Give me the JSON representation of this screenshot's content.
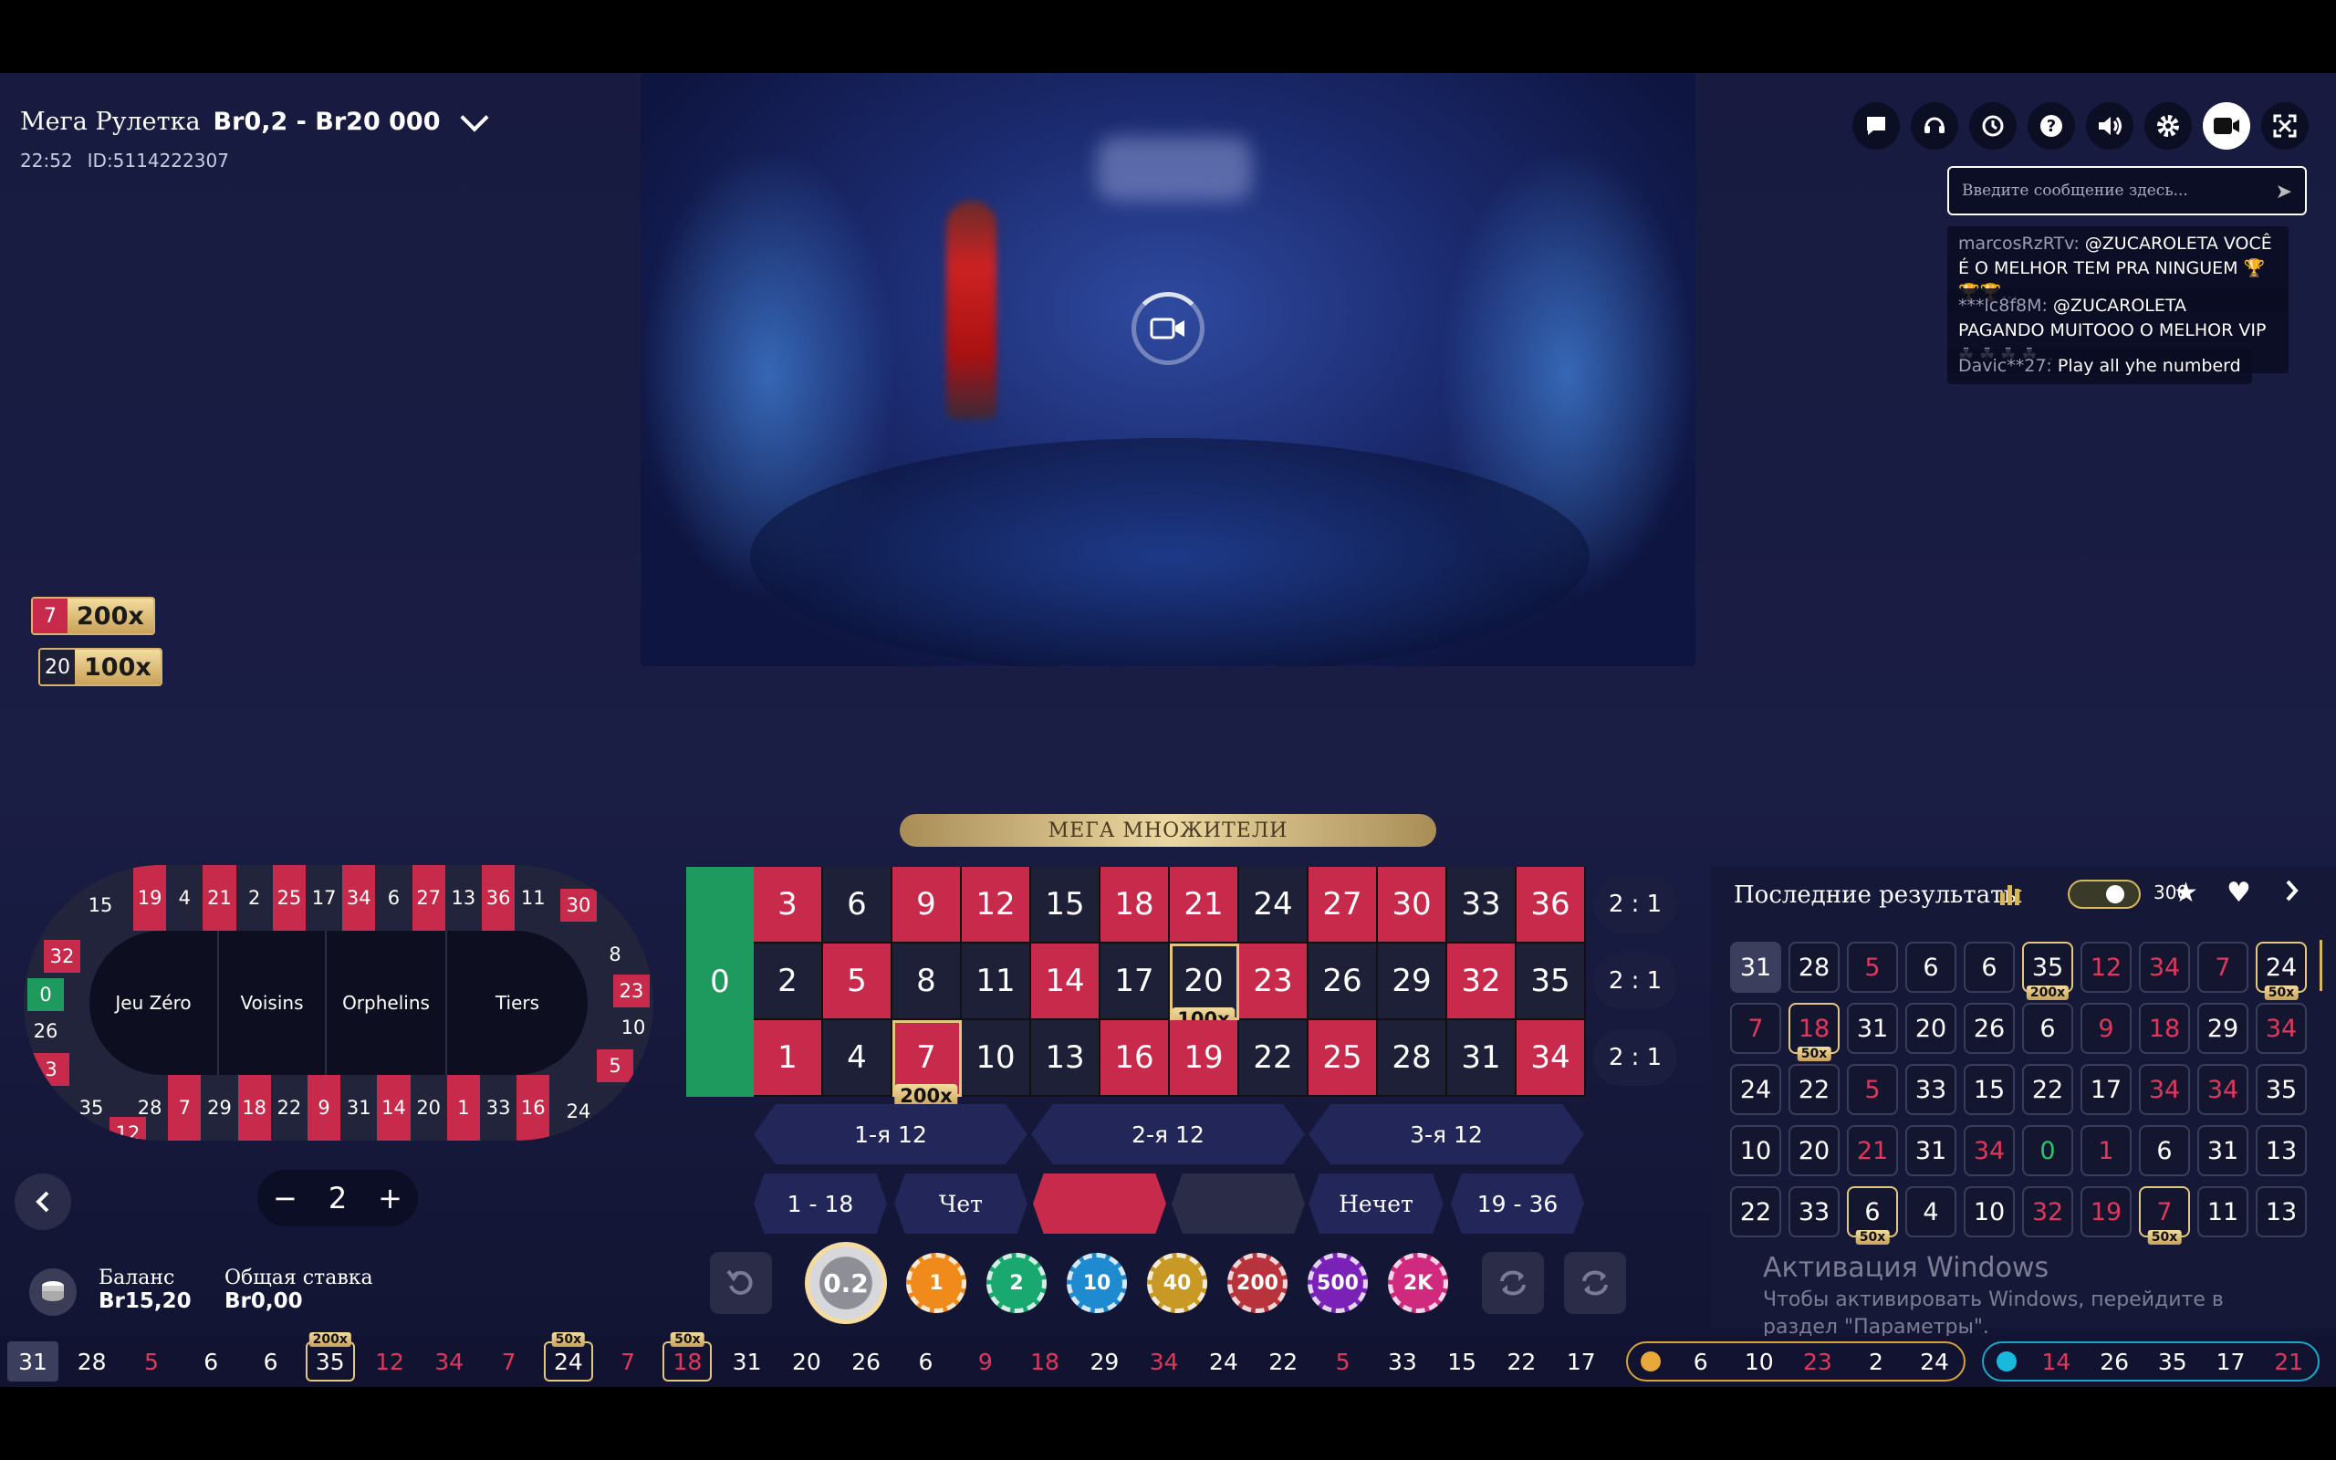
{
  "header": {
    "game_name": "Мега Рулетка",
    "limits": "Br0,2 - Br20 000",
    "time": "22:52",
    "id": "ID:5114222307"
  },
  "toolbar_icons": [
    "chat-icon",
    "support-icon",
    "history-icon",
    "help-icon",
    "sound-icon",
    "settings-icon",
    "video-icon",
    "fullscreen-icon"
  ],
  "chat": {
    "placeholder": "Введите сообщение здесь...",
    "messages": [
      {
        "user": "marcosRzRTv:",
        "text": " @ZUCAROLETA VOCÊ É O MELHOR TEM PRA NINGUEM 🏆🏆🏆..."
      },
      {
        "user": "***lc8f8M:",
        "text": " @ZUCAROLETA PAGANDO MUITOOO O MELHOR VIP ☘ ☘ ☘ ☘..."
      },
      {
        "user": "Davic**27:",
        "text": " Play all yhe numberd"
      }
    ]
  },
  "multipliers": [
    {
      "number": "7",
      "mult": "200x"
    },
    {
      "number": "20",
      "mult": "100x"
    }
  ],
  "racetrack": {
    "sections": [
      "Jeu Zéro",
      "Voisins",
      "Orphelins",
      "Tiers"
    ],
    "top": [
      "19",
      "4",
      "21",
      "2",
      "25",
      "17",
      "34",
      "6",
      "27",
      "13",
      "36",
      "11"
    ],
    "bottom": [
      "28",
      "7",
      "29",
      "18",
      "22",
      "9",
      "31",
      "14",
      "20",
      "1",
      "33",
      "16"
    ],
    "left": [
      "15",
      "32",
      "0",
      "26",
      "3",
      "35",
      "12"
    ],
    "right": [
      "30",
      "8",
      "23",
      "10",
      "5",
      "24"
    ]
  },
  "banner": "МЕГА МНОЖИТЕЛИ",
  "table": {
    "zero": "0",
    "rows": [
      [
        "3",
        "6",
        "9",
        "12",
        "15",
        "18",
        "21",
        "24",
        "27",
        "30",
        "33",
        "36"
      ],
      [
        "2",
        "5",
        "8",
        "11",
        "14",
        "17",
        "20",
        "23",
        "26",
        "29",
        "32",
        "35"
      ],
      [
        "1",
        "4",
        "7",
        "10",
        "13",
        "16",
        "19",
        "22",
        "25",
        "28",
        "31",
        "34"
      ]
    ],
    "column_bets": [
      "2 : 1",
      "2 : 1",
      "2 : 1"
    ],
    "dozens": [
      "1-я 12",
      "2-я 12",
      "3-я 12"
    ],
    "outside": {
      "low": "1 - 18",
      "even": "Чет",
      "odd": "Нечет",
      "high": "19 - 36"
    },
    "mult_badges": {
      "7": "200x",
      "20": "100x"
    }
  },
  "stepper_value": "2",
  "chips": [
    "0.2",
    "1",
    "2",
    "10",
    "40",
    "200",
    "500",
    "2K"
  ],
  "balance": {
    "label": "Баланс",
    "value": "Br15,20"
  },
  "total_bet": {
    "label": "Общая ставка",
    "value": "Br0,00"
  },
  "results": {
    "title": "Последние результаты",
    "count": "300",
    "grid": [
      [
        "31",
        "28",
        "5",
        "6",
        "6",
        "35",
        "12",
        "34",
        "7",
        "24"
      ],
      [
        "7",
        "18",
        "31",
        "20",
        "26",
        "6",
        "9",
        "18",
        "29",
        "34"
      ],
      [
        "24",
        "22",
        "5",
        "33",
        "15",
        "22",
        "17",
        "34",
        "34",
        "35"
      ],
      [
        "10",
        "20",
        "21",
        "31",
        "34",
        "0",
        "1",
        "6",
        "31",
        "13"
      ],
      [
        "22",
        "33",
        "6",
        "4",
        "10",
        "32",
        "19",
        "7",
        "11",
        "13"
      ]
    ],
    "badges": {
      "0-5": "200x",
      "0-9": "50x",
      "1-1": "50x",
      "4-2": "50x",
      "4-7": "50x"
    }
  },
  "windows_activation": {
    "title": "Активация Windows",
    "text": "Чтобы активировать Windows, перейдите в раздел \"Параметры\"."
  },
  "history": {
    "items": [
      "31",
      "28",
      "5",
      "6",
      "6",
      "35",
      "12",
      "34",
      "7",
      "24",
      "7",
      "18",
      "31",
      "20",
      "26",
      "6",
      "9",
      "18",
      "29",
      "34",
      "24",
      "22",
      "5",
      "33",
      "15",
      "22",
      "17"
    ],
    "badges": {
      "5": "200x",
      "9": "50x",
      "11": "50x"
    },
    "group1": [
      "6",
      "10",
      "23",
      "2",
      "24"
    ],
    "group2": [
      "14",
      "26",
      "35",
      "17",
      "21"
    ]
  },
  "colors": {
    "red": "#c72a4a",
    "black": "#1d2036",
    "green": "#1f9a5e",
    "gold": "#e4c77f"
  },
  "reds": [
    "1",
    "3",
    "5",
    "7",
    "9",
    "12",
    "14",
    "16",
    "18",
    "19",
    "21",
    "23",
    "25",
    "27",
    "30",
    "32",
    "34",
    "36"
  ]
}
